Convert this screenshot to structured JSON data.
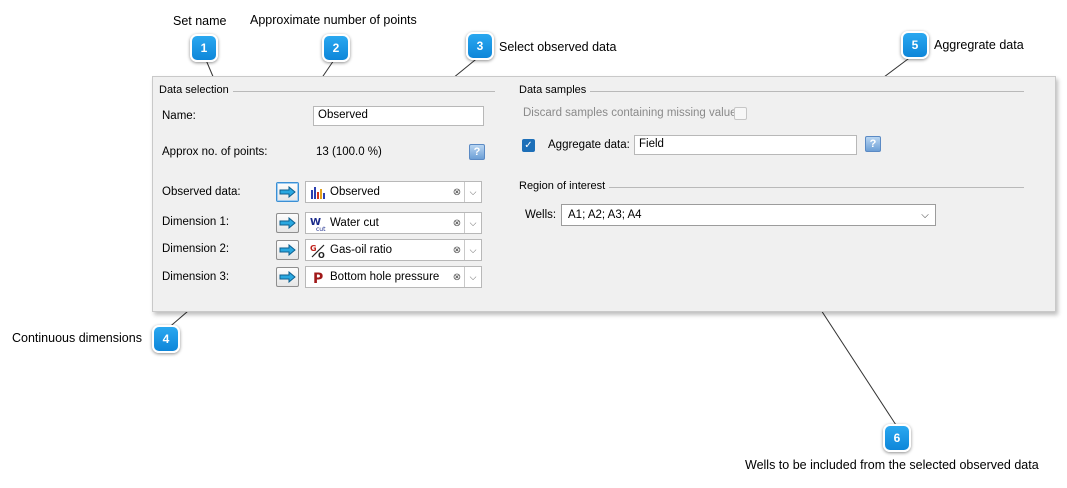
{
  "callouts": [
    {
      "num": "1",
      "text": "Set name"
    },
    {
      "num": "2",
      "text": "Approximate number of points"
    },
    {
      "num": "3",
      "text": "Select observed data"
    },
    {
      "num": "4",
      "text": "Continuous dimensions"
    },
    {
      "num": "5",
      "text": "Aggregrate data"
    },
    {
      "num": "6",
      "text": "Wells to be included from the selected observed data"
    }
  ],
  "data_selection": {
    "title": "Data selection",
    "name_label": "Name:",
    "name_value": "Observed",
    "approx_label": "Approx no. of points:",
    "approx_value": "13 (100.0 %)",
    "help_glyph": "?",
    "rows": [
      {
        "label": "Observed data:",
        "value": "Observed",
        "icon": "bar-chart-icon"
      },
      {
        "label": "Dimension 1:",
        "value": "Water cut",
        "icon": "water-cut-icon"
      },
      {
        "label": "Dimension 2:",
        "value": "Gas-oil ratio",
        "icon": "gas-oil-ratio-icon"
      },
      {
        "label": "Dimension 3:",
        "value": "Bottom hole pressure",
        "icon": "pressure-icon"
      }
    ]
  },
  "data_samples": {
    "title": "Data samples",
    "discard_label": "Discard samples containing missing values:",
    "discard_checked": false,
    "aggregate_label": "Aggregate data:",
    "aggregate_checked": true,
    "aggregate_value": "Field",
    "help_glyph": "?"
  },
  "region": {
    "title": "Region of interest",
    "wells_label": "Wells:",
    "wells_value": "A1; A2; A3; A4"
  },
  "colors": {
    "badge": "#1a96e6",
    "arrow": "#2aa8e0",
    "check": "#1d6fb8"
  }
}
